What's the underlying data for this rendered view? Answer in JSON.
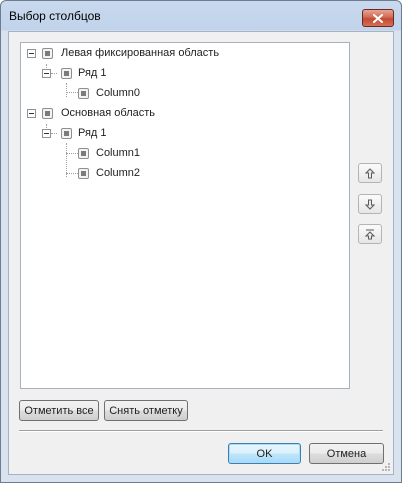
{
  "window": {
    "title": "Выбор столбцов"
  },
  "tree": {
    "groups": [
      {
        "label": "Левая фиксированная область",
        "rows": [
          {
            "label": "Ряд 1",
            "columns": [
              "Column0"
            ]
          }
        ]
      },
      {
        "label": "Основная область",
        "rows": [
          {
            "label": "Ряд 1",
            "columns": [
              "Column1",
              "Column2"
            ]
          }
        ]
      }
    ]
  },
  "actions": {
    "select_all": "Отметить все",
    "clear_selection": "Снять отметку"
  },
  "footer": {
    "ok": "OK",
    "cancel": "Отмена"
  },
  "side_buttons": {
    "move_up_icon": "arrow-up-icon",
    "move_down_icon": "arrow-down-icon",
    "move_top_icon": "arrow-up-top-icon"
  }
}
